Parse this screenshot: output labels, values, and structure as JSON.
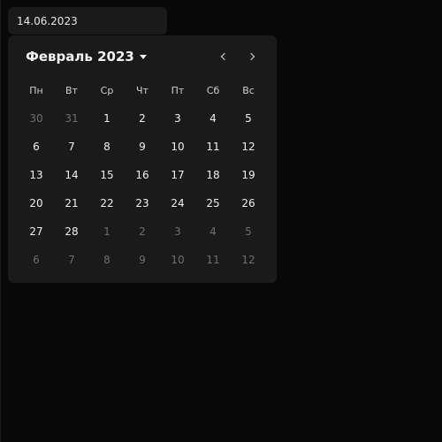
{
  "input": {
    "value": "14.06.2023"
  },
  "calendar": {
    "month_label": "Февраль 2023",
    "weekdays": [
      "Пн",
      "Вт",
      "Ср",
      "Чт",
      "Пт",
      "Сб",
      "Вс"
    ],
    "weeks": [
      [
        {
          "d": "30",
          "out": true
        },
        {
          "d": "31",
          "out": true
        },
        {
          "d": "1",
          "out": false
        },
        {
          "d": "2",
          "out": false
        },
        {
          "d": "3",
          "out": false
        },
        {
          "d": "4",
          "out": false
        },
        {
          "d": "5",
          "out": false
        }
      ],
      [
        {
          "d": "6",
          "out": false
        },
        {
          "d": "7",
          "out": false
        },
        {
          "d": "8",
          "out": false
        },
        {
          "d": "9",
          "out": false
        },
        {
          "d": "10",
          "out": false
        },
        {
          "d": "11",
          "out": false
        },
        {
          "d": "12",
          "out": false
        }
      ],
      [
        {
          "d": "13",
          "out": false
        },
        {
          "d": "14",
          "out": false
        },
        {
          "d": "15",
          "out": false
        },
        {
          "d": "16",
          "out": false
        },
        {
          "d": "17",
          "out": false
        },
        {
          "d": "18",
          "out": false
        },
        {
          "d": "19",
          "out": false
        }
      ],
      [
        {
          "d": "20",
          "out": false
        },
        {
          "d": "21",
          "out": false
        },
        {
          "d": "22",
          "out": false
        },
        {
          "d": "23",
          "out": false
        },
        {
          "d": "24",
          "out": false
        },
        {
          "d": "25",
          "out": false
        },
        {
          "d": "26",
          "out": false
        }
      ],
      [
        {
          "d": "27",
          "out": false
        },
        {
          "d": "28",
          "out": false
        },
        {
          "d": "1",
          "out": true
        },
        {
          "d": "2",
          "out": true
        },
        {
          "d": "3",
          "out": true
        },
        {
          "d": "4",
          "out": true
        },
        {
          "d": "5",
          "out": true
        }
      ],
      [
        {
          "d": "6",
          "out": true
        },
        {
          "d": "7",
          "out": true
        },
        {
          "d": "8",
          "out": true
        },
        {
          "d": "9",
          "out": true
        },
        {
          "d": "10",
          "out": true
        },
        {
          "d": "11",
          "out": true
        },
        {
          "d": "12",
          "out": true
        }
      ]
    ]
  },
  "icons": {
    "month_dropdown": "caret-down-icon",
    "prev": "chevron-left-icon",
    "next": "chevron-right-icon"
  },
  "colors": {
    "background": "#080808",
    "surface": "#1a1a1a",
    "text": "#f0f0f0",
    "muted_text": "#6e6e6e"
  }
}
